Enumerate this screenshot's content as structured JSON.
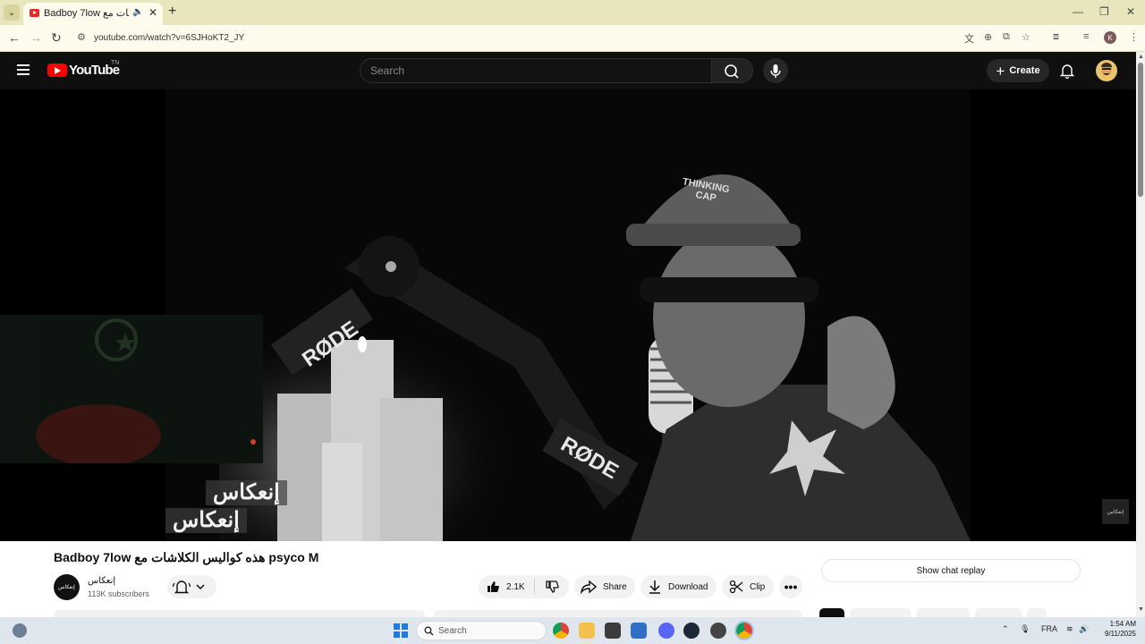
{
  "browser": {
    "tab_title": "Badboy 7low هذه كواليس الكلاشات مع",
    "url": "youtube.com/watch?v=6SJHoKT2_JY",
    "profile_initial": "K"
  },
  "youtube": {
    "logo_text": "YouTube",
    "region": "TN",
    "search_placeholder": "Search",
    "create_label": "Create"
  },
  "video": {
    "overlay_text": "إنعكاس",
    "title": "Badboy 7low هذه كواليس الكلاشات مع psyco M",
    "channel_name": "إنعكاس",
    "subscribers": "113K subscribers",
    "likes": "2.1K",
    "share_label": "Share",
    "download_label": "Download",
    "clip_label": "Clip",
    "more_label": "•••",
    "chat_replay_label": "Show chat replay"
  },
  "taskbar": {
    "search_label": "Search",
    "language": "FRA",
    "time": "1:54 AM",
    "date": "9/11/2025"
  },
  "colors": {
    "browser_frame": "#e9e5bd",
    "youtube_red": "#ff0000",
    "masthead_bg": "#0f0f0f"
  }
}
